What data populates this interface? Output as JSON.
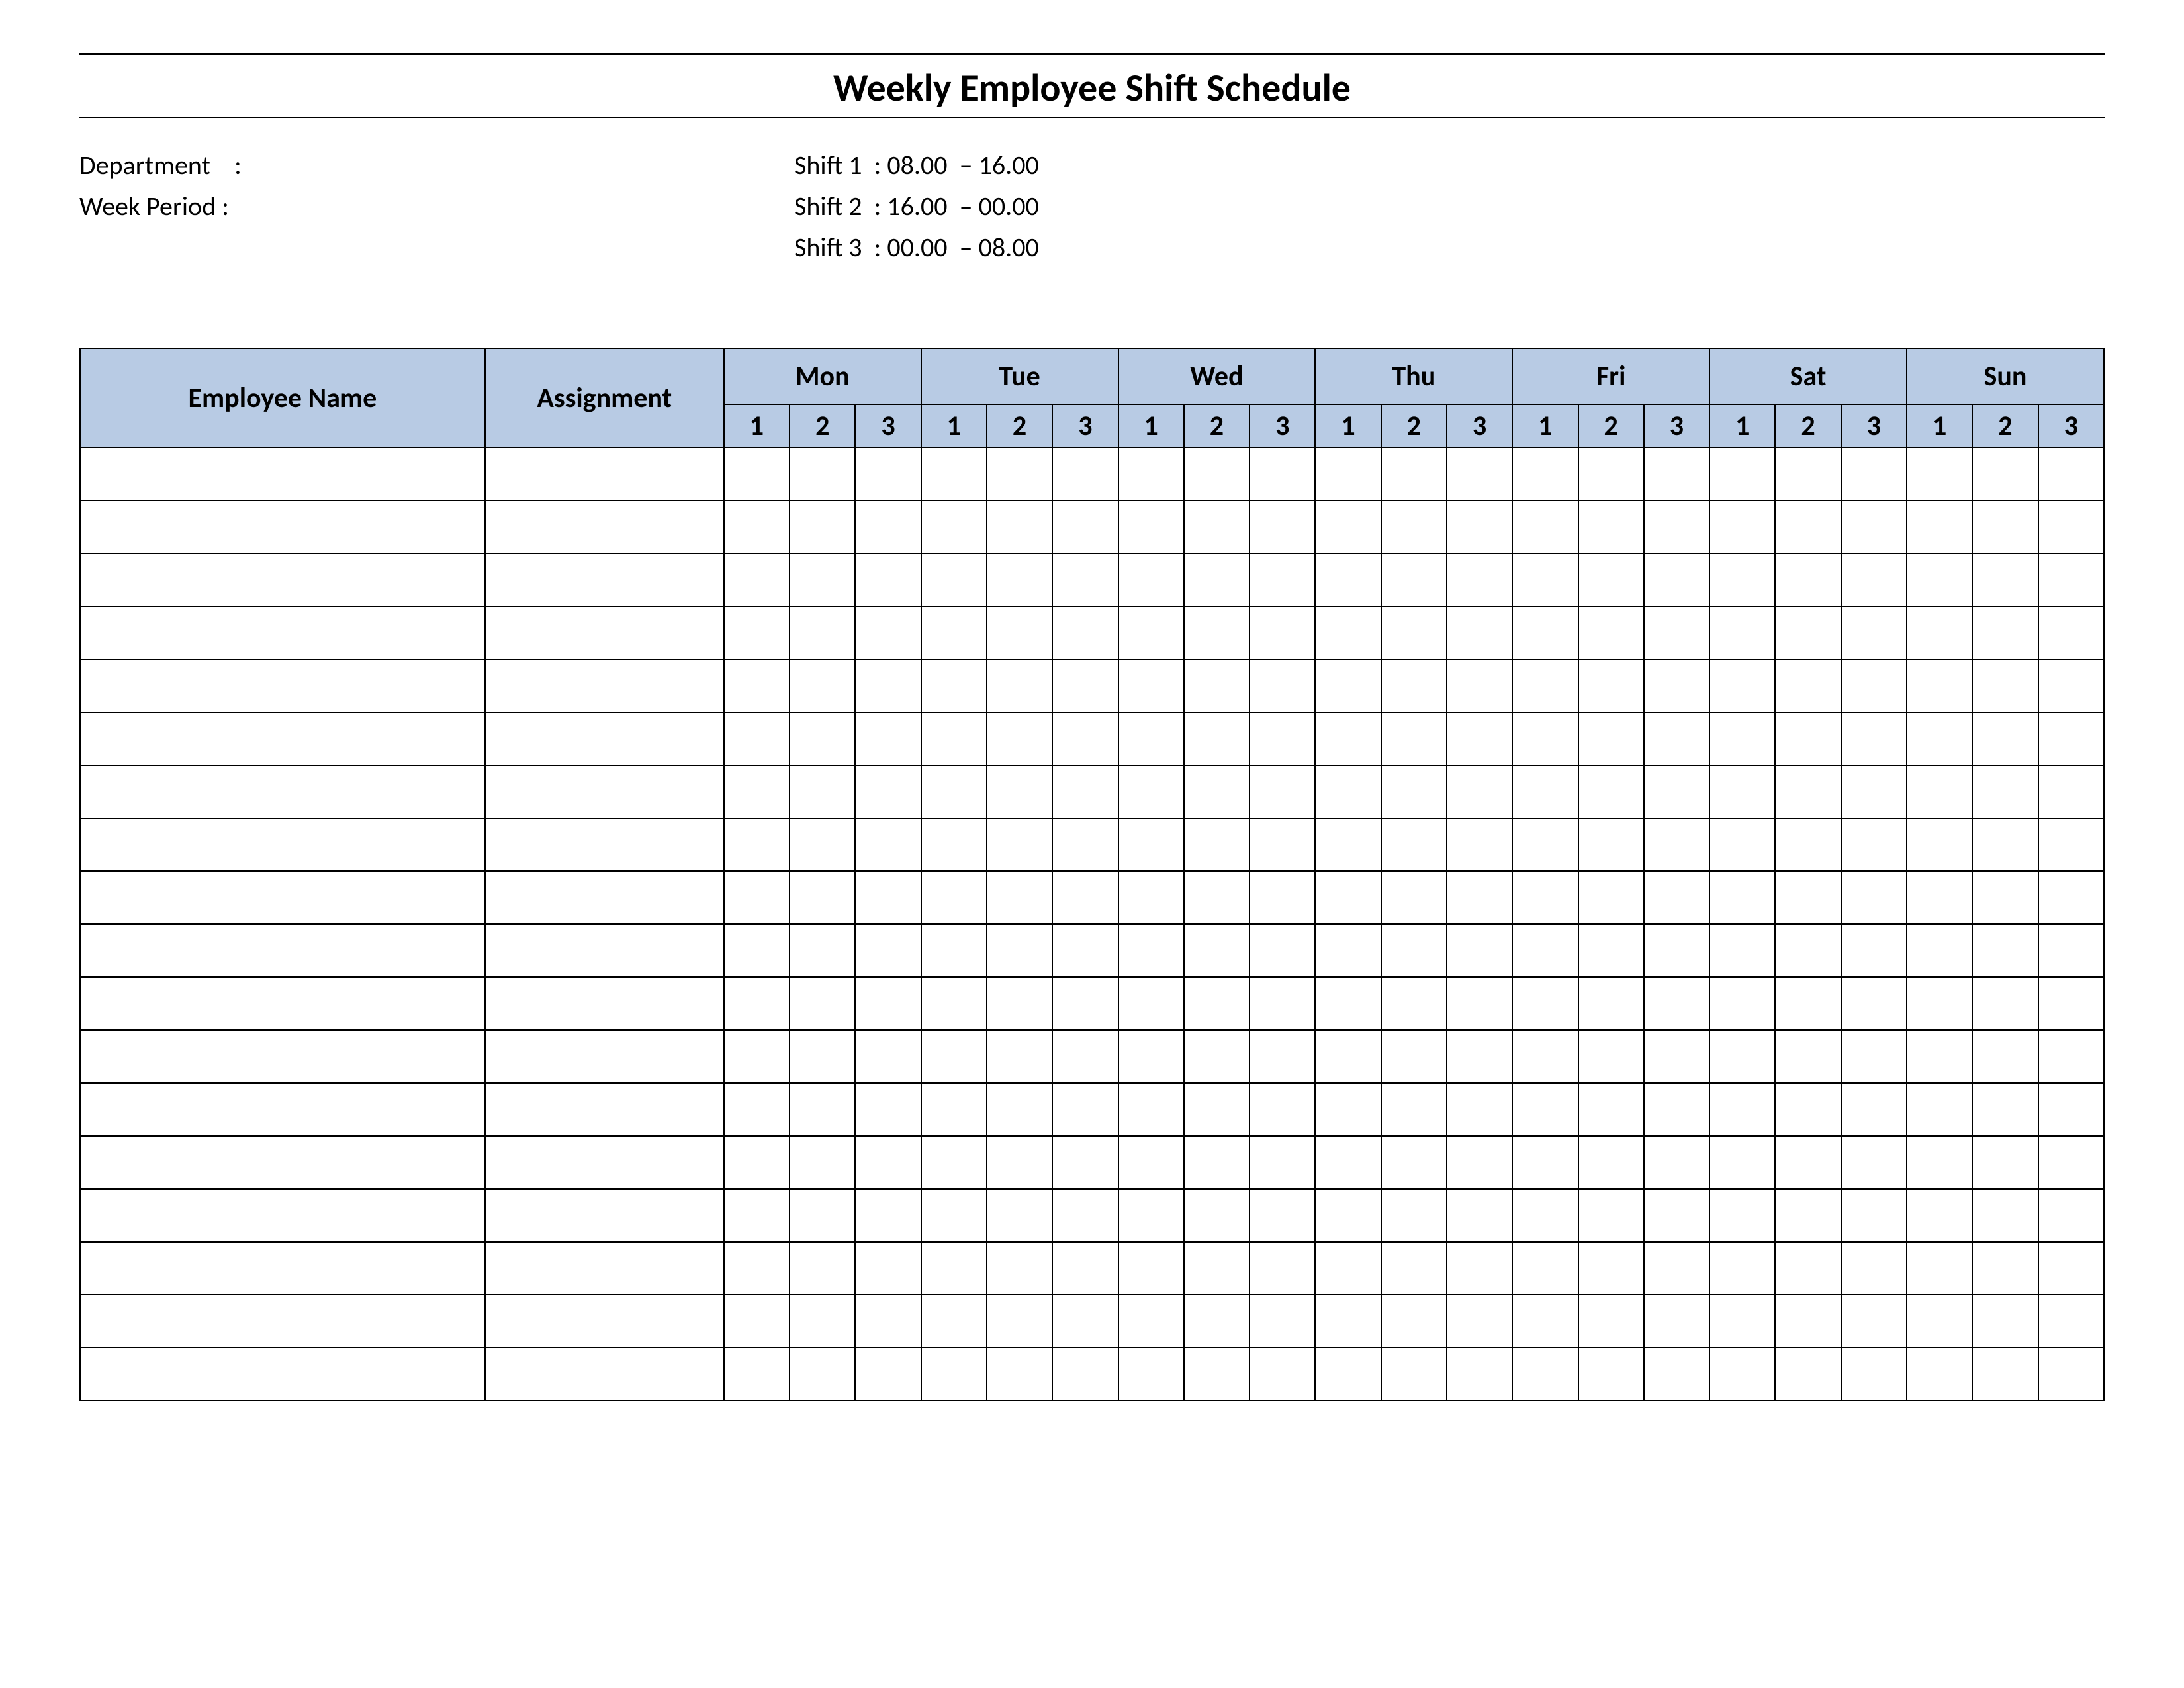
{
  "title": "Weekly Employee Shift Schedule",
  "meta": {
    "department_label": "Department",
    "department_sep": ":",
    "department_value": "",
    "week_period_label": "Week  Period",
    "week_period_sep": ":",
    "week_period_value": "",
    "shift1_label": "Shift 1",
    "shift1_sep": ":",
    "shift1_value": "08.00  – 16.00",
    "shift2_label": "Shift 2",
    "shift2_sep": ":",
    "shift2_value": "16.00  – 00.00",
    "shift3_label": "Shift 3",
    "shift3_sep": ":",
    "shift3_value": "00.00  – 08.00"
  },
  "headers": {
    "employee": "Employee Name",
    "assignment": "Assignment",
    "days": [
      "Mon",
      "Tue",
      "Wed",
      "Thu",
      "Fri",
      "Sat",
      "Sun"
    ],
    "shifts": [
      "1",
      "2",
      "3"
    ]
  },
  "rows": 18
}
